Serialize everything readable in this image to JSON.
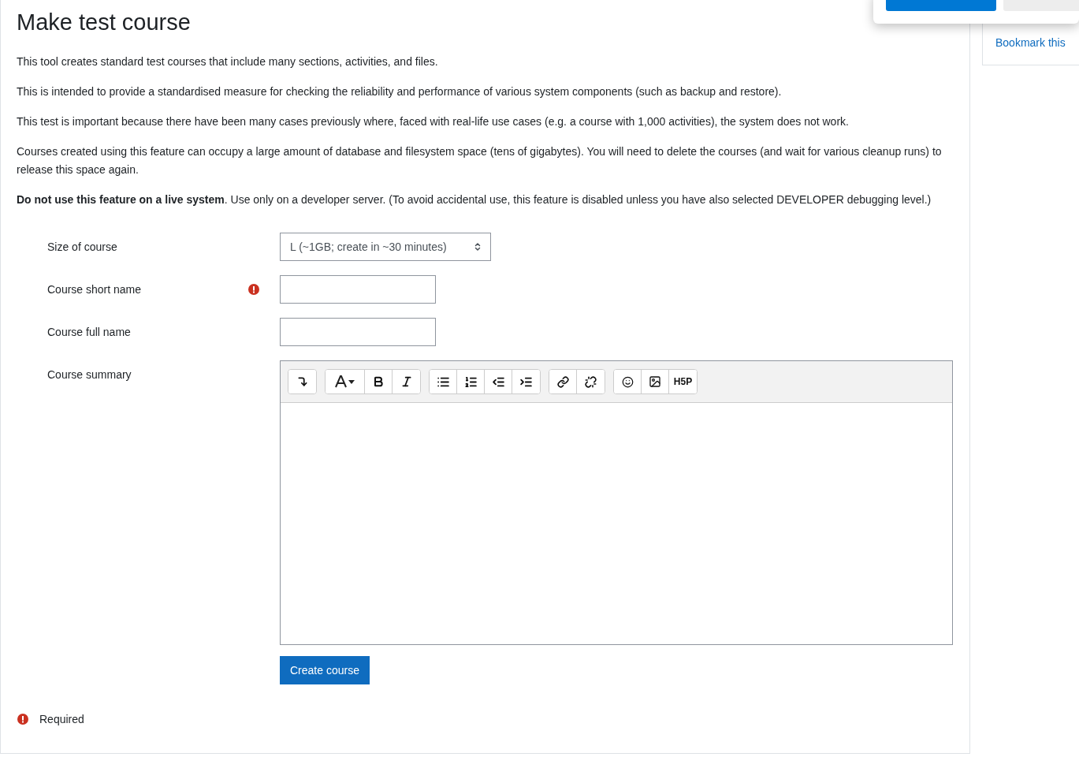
{
  "page_title": "Make test course",
  "paragraphs": [
    "This tool creates standard test courses that include many sections, activities, and files.",
    "This is intended to provide a standardised measure for checking the reliability and performance of various system components (such as backup and restore).",
    "This test is important because there have been many cases previously where, faced with real-life use cases (e.g. a course with 1,000 activities), the system does not work.",
    "Courses created using this feature can occupy a large amount of database and filesystem space (tens of gigabytes). You will need to delete the courses (and wait for various cleanup runs) to release this space again.",
    "**Do not use this feature on a live system**. Use only on a developer server. (To avoid accidental use, this feature is disabled unless you have also selected DEVELOPER debugging level.)"
  ],
  "form": {
    "fields": [
      {
        "kind": "select",
        "label": "Size of course",
        "required": false,
        "value": "L (~1GB; create in ~30 minutes)"
      },
      {
        "kind": "text",
        "label": "Course short name",
        "required": true
      },
      {
        "kind": "text",
        "label": "Course full name",
        "required": false
      },
      {
        "kind": "editor",
        "label": "Course summary",
        "required": false,
        "toolbar": [
          [
            {
              "kind": "collapse"
            }
          ],
          [
            {
              "kind": "font"
            },
            {
              "kind": "bold"
            },
            {
              "kind": "italic"
            }
          ],
          [
            {
              "kind": "bullets"
            },
            {
              "kind": "numbers"
            },
            {
              "kind": "outdent"
            },
            {
              "kind": "indent"
            }
          ],
          [
            {
              "kind": "link"
            },
            {
              "kind": "unlink"
            }
          ],
          [
            {
              "kind": "emoji"
            },
            {
              "kind": "image"
            },
            {
              "kind": "h5p",
              "label": "H5P"
            }
          ]
        ]
      }
    ],
    "submit": "Create course",
    "required_note": "Required"
  },
  "sidebar": {
    "link": "Bookmark this"
  },
  "popup": {
    "buttons": [
      {
        "kind": "primary"
      },
      {
        "kind": "secondary"
      }
    ]
  }
}
